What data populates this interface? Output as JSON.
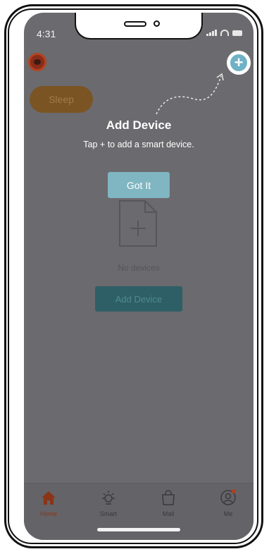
{
  "status": {
    "time": "4:31"
  },
  "home": {
    "chip_label": "Sleep",
    "empty_label": "No devices",
    "add_button_label": "Add Device"
  },
  "coach": {
    "title": "Add Device",
    "subtitle": "Tap + to add a smart device.",
    "button_label": "Got It",
    "plus_symbol": "+"
  },
  "tabs": [
    {
      "label": "Home",
      "icon": "home-icon",
      "active": true
    },
    {
      "label": "Smart",
      "icon": "sun-icon",
      "active": false
    },
    {
      "label": "Mall",
      "icon": "bag-icon",
      "active": false
    },
    {
      "label": "Me",
      "icon": "profile-icon",
      "active": false
    }
  ],
  "colors": {
    "overlay_bg": "#6b6a6e",
    "accent_teal": "#7fb6c2",
    "active_tab": "#8a3418"
  }
}
